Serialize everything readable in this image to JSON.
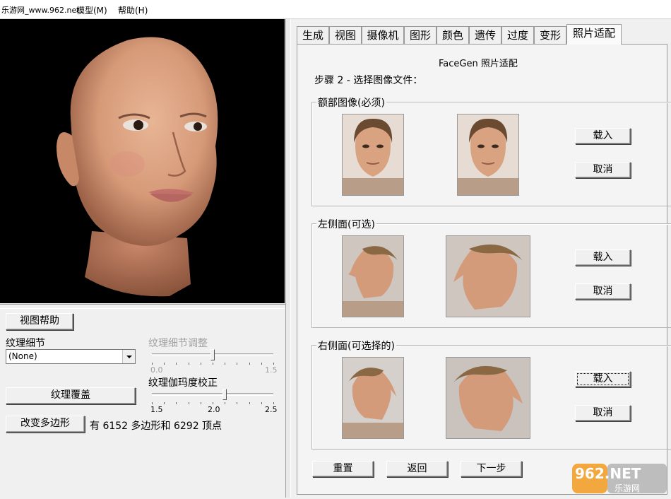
{
  "menubar": {
    "site_label": "乐游网_www.962.net",
    "items": [
      "模型(M)",
      "帮助(H)"
    ]
  },
  "left_panel": {
    "view_help_button": "视图帮助",
    "texture_detail_label": "纹理细节",
    "texture_detail_value": "(None)",
    "texture_detail_adjust_label": "纹理细节调整",
    "texture_detail_adjust_min": "0.0",
    "texture_detail_adjust_max": "1.5",
    "texture_detail_adjust_value": 0.75,
    "texture_overlay_button": "纹理覆盖",
    "gamma_label": "纹理伽玛度校正",
    "gamma_min": "1.5",
    "gamma_mid": "2.0",
    "gamma_max": "2.5",
    "gamma_value": 2.1,
    "change_polygons_button": "改变多边形",
    "polygon_info": "有 6152 多边形和 6292 顶点"
  },
  "tabs": [
    "生成",
    "视图",
    "摄像机",
    "图形",
    "颜色",
    "遗传",
    "过度",
    "变形",
    "照片适配"
  ],
  "active_tab": "照片适配",
  "photo_fit": {
    "title": "FaceGen 照片适配",
    "step": "步骤 2 - 选择图像文件：",
    "groups": [
      {
        "label": "额部图像(必须)",
        "load": "载入",
        "cancel": "取消"
      },
      {
        "label": "左侧面(可选)",
        "load": "载入",
        "cancel": "取消"
      },
      {
        "label": "右侧面(可选择的)",
        "load": "载入",
        "cancel": "取消"
      }
    ],
    "reset_button": "重置",
    "back_button": "返回",
    "next_button": "下一步"
  },
  "watermark": {
    "brand": "962.NET",
    "sub": "乐游网"
  },
  "colors": {
    "skin": "#d9a07e",
    "bg_dark": "#000000",
    "panel": "#f0f0f0",
    "watermark_orange": "#f29a1f"
  }
}
